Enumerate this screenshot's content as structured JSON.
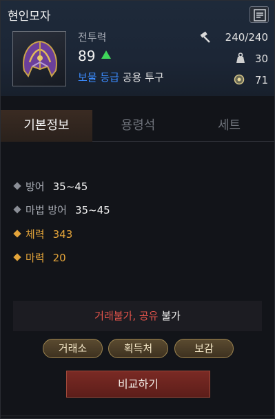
{
  "item": {
    "name": "현인모자",
    "power_label": "전투력",
    "power_value": "89",
    "grade": "보물 등급",
    "slot": "공용 투구"
  },
  "stats": {
    "durability": "240/240",
    "weight": "30",
    "level": "71"
  },
  "tabs": [
    {
      "label": "기본정보",
      "active": true
    },
    {
      "label": "용령석",
      "active": false
    },
    {
      "label": "세트",
      "active": false
    }
  ],
  "attributes": [
    {
      "name": "방어",
      "value": "35~45",
      "style": "grey"
    },
    {
      "name": "마법 방어",
      "value": "35~45",
      "style": "grey"
    },
    {
      "name": "체력",
      "value": "343",
      "style": "gold"
    },
    {
      "name": "마력",
      "value": "20",
      "style": "gold"
    }
  ],
  "trade": {
    "restriction": "거래불가, 공유",
    "suffix": " 불가"
  },
  "buttons": {
    "exchange": "거래소",
    "source": "획득처",
    "collection": "보감",
    "compare": "비교하기"
  },
  "colors": {
    "grade": "#3b8cff",
    "gold_attr": "#e3a43a",
    "trade_red": "#e2534b",
    "power_up": "#3fd65a"
  },
  "icons": {
    "helmet": "helmet-icon",
    "corner": "expand-icon",
    "durability": "hammer-icon",
    "weight": "weight-icon",
    "level": "level-icon",
    "power_change": "arrow-up-icon"
  }
}
